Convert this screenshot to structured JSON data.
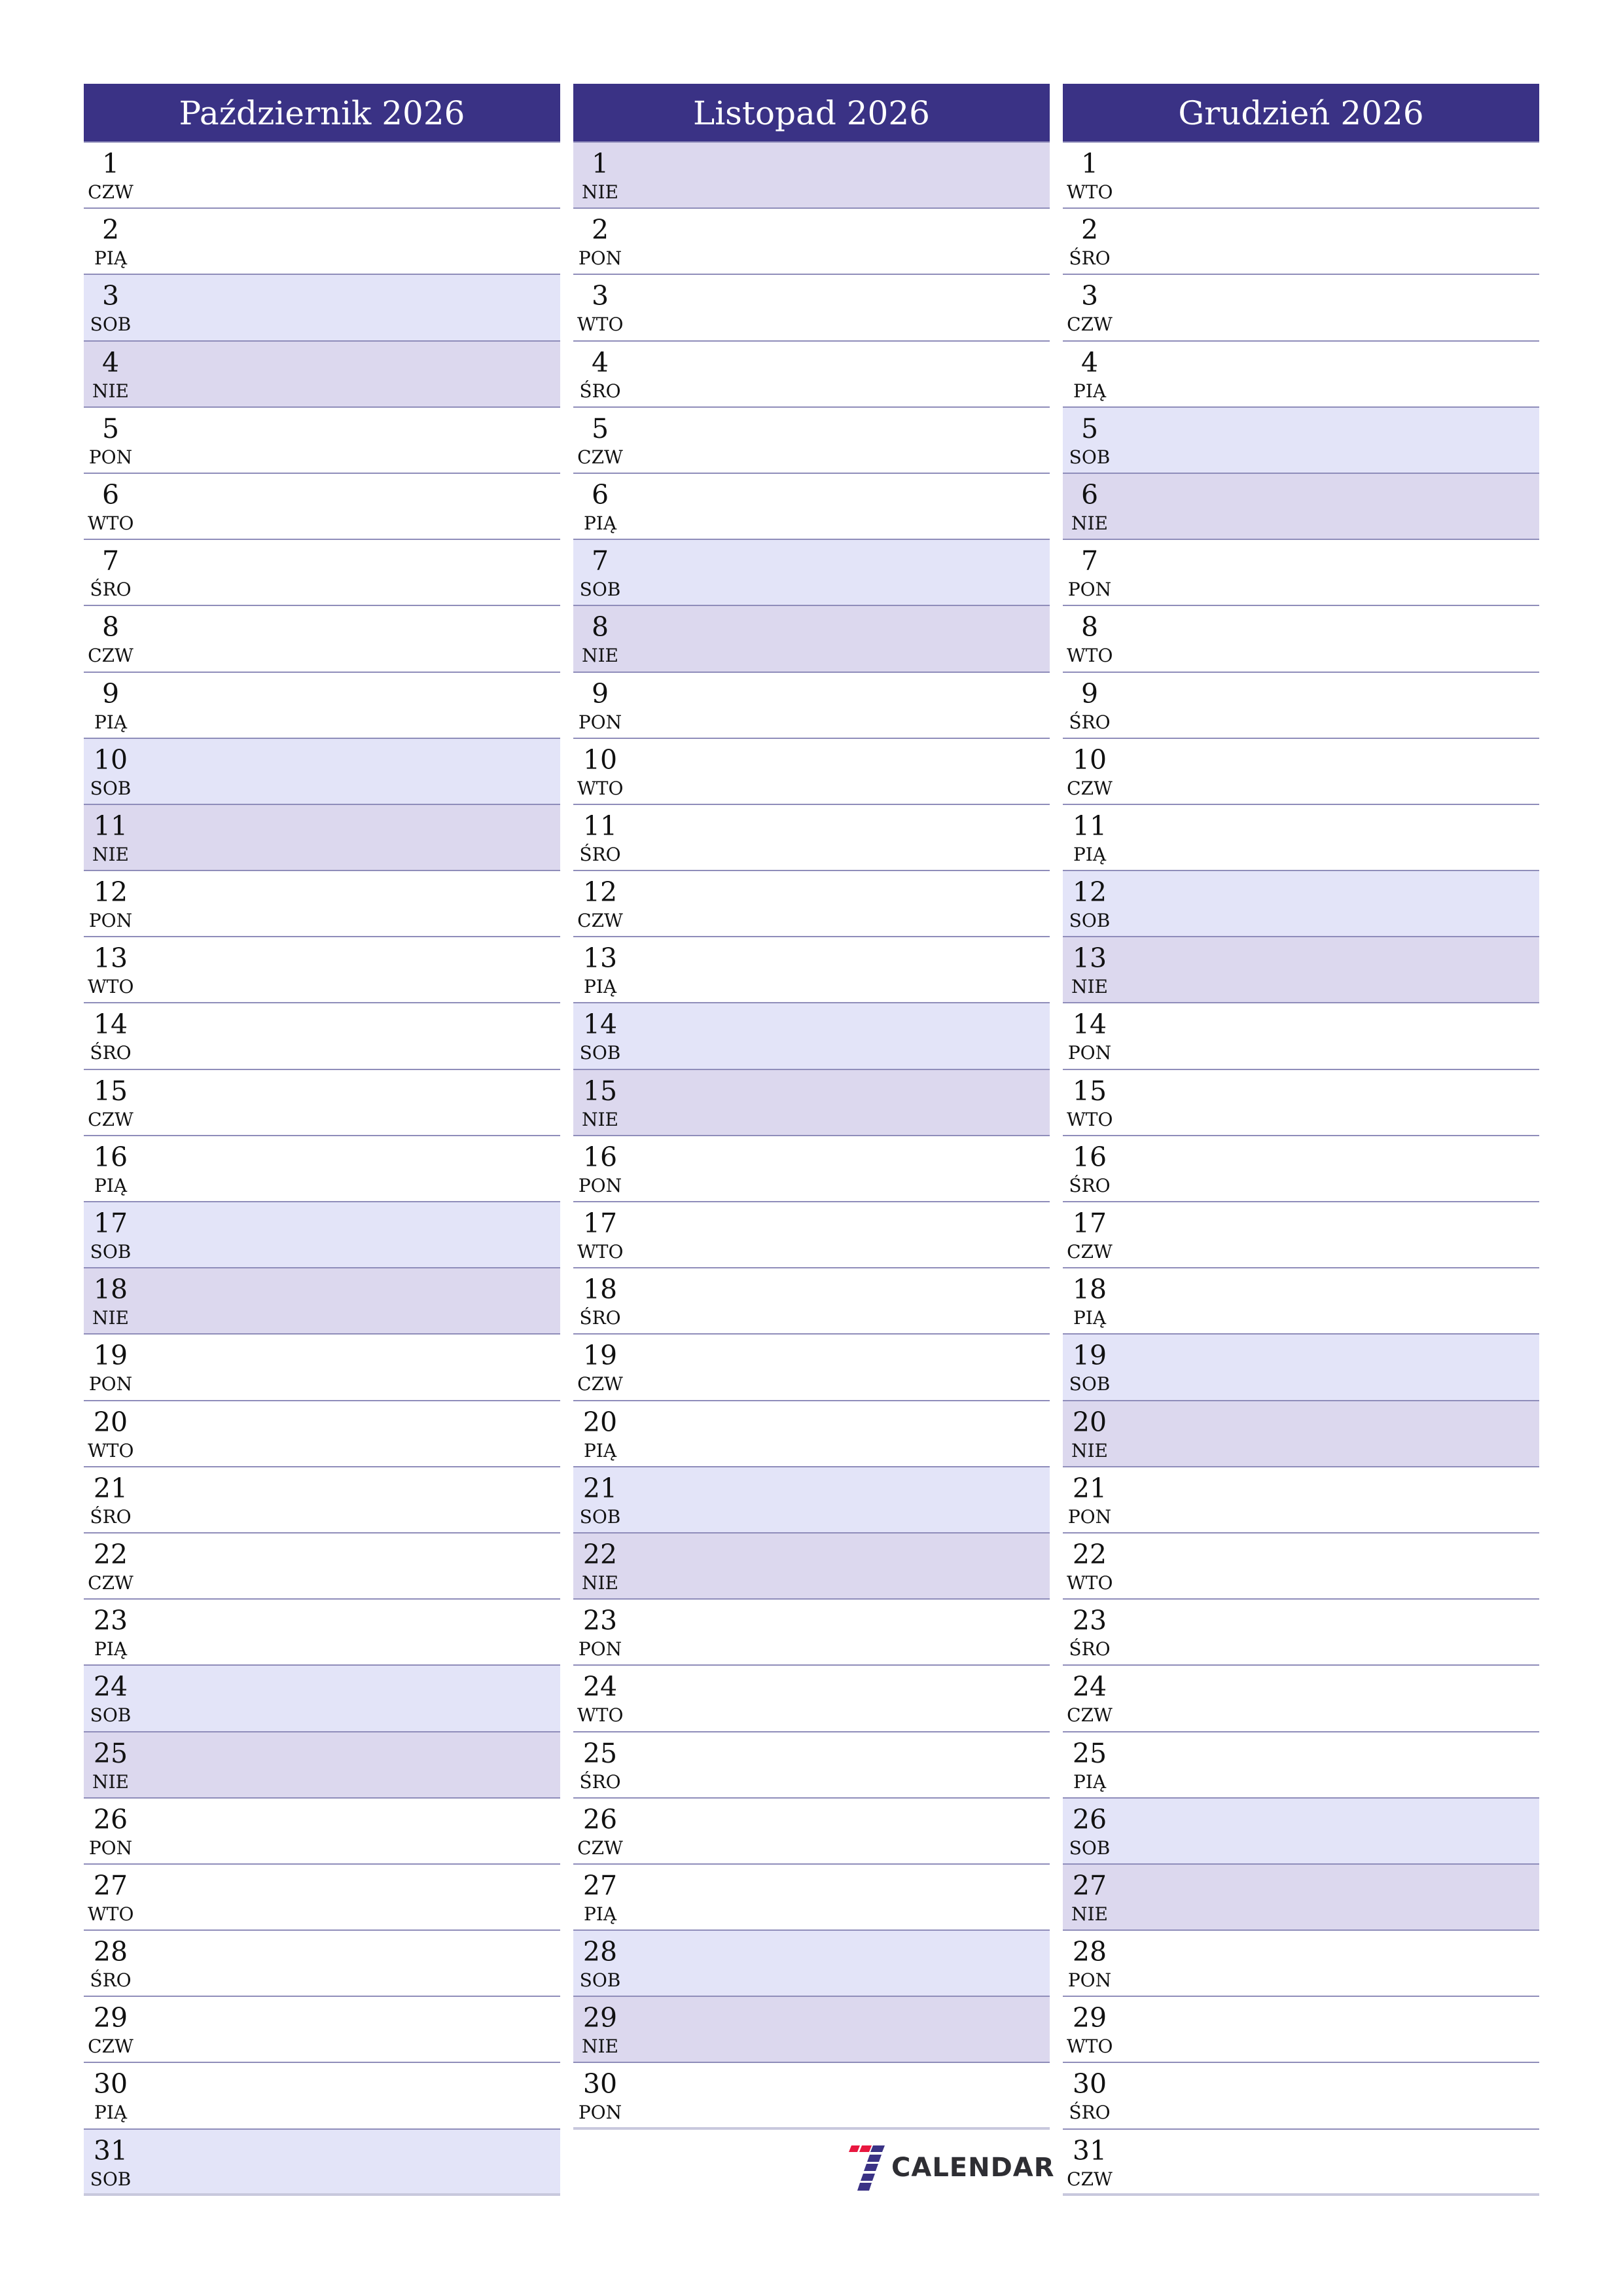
{
  "colors": {
    "header_bg": "#3a3285",
    "saturday_bg": "#e3e4f8",
    "sunday_bg": "#dcd8ee",
    "divider": "#8f8dba",
    "logo_red": "#e8173f",
    "logo_blue": "#3a3285",
    "logo_text": "#2e2e33"
  },
  "months": [
    {
      "title": "Październik 2026",
      "days": [
        {
          "day": "1",
          "weekday": "CZW"
        },
        {
          "day": "2",
          "weekday": "PIĄ"
        },
        {
          "day": "3",
          "weekday": "SOB"
        },
        {
          "day": "4",
          "weekday": "NIE"
        },
        {
          "day": "5",
          "weekday": "PON"
        },
        {
          "day": "6",
          "weekday": "WTO"
        },
        {
          "day": "7",
          "weekday": "ŚRO"
        },
        {
          "day": "8",
          "weekday": "CZW"
        },
        {
          "day": "9",
          "weekday": "PIĄ"
        },
        {
          "day": "10",
          "weekday": "SOB"
        },
        {
          "day": "11",
          "weekday": "NIE"
        },
        {
          "day": "12",
          "weekday": "PON"
        },
        {
          "day": "13",
          "weekday": "WTO"
        },
        {
          "day": "14",
          "weekday": "ŚRO"
        },
        {
          "day": "15",
          "weekday": "CZW"
        },
        {
          "day": "16",
          "weekday": "PIĄ"
        },
        {
          "day": "17",
          "weekday": "SOB"
        },
        {
          "day": "18",
          "weekday": "NIE"
        },
        {
          "day": "19",
          "weekday": "PON"
        },
        {
          "day": "20",
          "weekday": "WTO"
        },
        {
          "day": "21",
          "weekday": "ŚRO"
        },
        {
          "day": "22",
          "weekday": "CZW"
        },
        {
          "day": "23",
          "weekday": "PIĄ"
        },
        {
          "day": "24",
          "weekday": "SOB"
        },
        {
          "day": "25",
          "weekday": "NIE"
        },
        {
          "day": "26",
          "weekday": "PON"
        },
        {
          "day": "27",
          "weekday": "WTO"
        },
        {
          "day": "28",
          "weekday": "ŚRO"
        },
        {
          "day": "29",
          "weekday": "CZW"
        },
        {
          "day": "30",
          "weekday": "PIĄ"
        },
        {
          "day": "31",
          "weekday": "SOB"
        }
      ]
    },
    {
      "title": "Listopad 2026",
      "days": [
        {
          "day": "1",
          "weekday": "NIE"
        },
        {
          "day": "2",
          "weekday": "PON"
        },
        {
          "day": "3",
          "weekday": "WTO"
        },
        {
          "day": "4",
          "weekday": "ŚRO"
        },
        {
          "day": "5",
          "weekday": "CZW"
        },
        {
          "day": "6",
          "weekday": "PIĄ"
        },
        {
          "day": "7",
          "weekday": "SOB"
        },
        {
          "day": "8",
          "weekday": "NIE"
        },
        {
          "day": "9",
          "weekday": "PON"
        },
        {
          "day": "10",
          "weekday": "WTO"
        },
        {
          "day": "11",
          "weekday": "ŚRO"
        },
        {
          "day": "12",
          "weekday": "CZW"
        },
        {
          "day": "13",
          "weekday": "PIĄ"
        },
        {
          "day": "14",
          "weekday": "SOB"
        },
        {
          "day": "15",
          "weekday": "NIE"
        },
        {
          "day": "16",
          "weekday": "PON"
        },
        {
          "day": "17",
          "weekday": "WTO"
        },
        {
          "day": "18",
          "weekday": "ŚRO"
        },
        {
          "day": "19",
          "weekday": "CZW"
        },
        {
          "day": "20",
          "weekday": "PIĄ"
        },
        {
          "day": "21",
          "weekday": "SOB"
        },
        {
          "day": "22",
          "weekday": "NIE"
        },
        {
          "day": "23",
          "weekday": "PON"
        },
        {
          "day": "24",
          "weekday": "WTO"
        },
        {
          "day": "25",
          "weekday": "ŚRO"
        },
        {
          "day": "26",
          "weekday": "CZW"
        },
        {
          "day": "27",
          "weekday": "PIĄ"
        },
        {
          "day": "28",
          "weekday": "SOB"
        },
        {
          "day": "29",
          "weekday": "NIE"
        },
        {
          "day": "30",
          "weekday": "PON"
        }
      ]
    },
    {
      "title": "Grudzień 2026",
      "days": [
        {
          "day": "1",
          "weekday": "WTO"
        },
        {
          "day": "2",
          "weekday": "ŚRO"
        },
        {
          "day": "3",
          "weekday": "CZW"
        },
        {
          "day": "4",
          "weekday": "PIĄ"
        },
        {
          "day": "5",
          "weekday": "SOB"
        },
        {
          "day": "6",
          "weekday": "NIE"
        },
        {
          "day": "7",
          "weekday": "PON"
        },
        {
          "day": "8",
          "weekday": "WTO"
        },
        {
          "day": "9",
          "weekday": "ŚRO"
        },
        {
          "day": "10",
          "weekday": "CZW"
        },
        {
          "day": "11",
          "weekday": "PIĄ"
        },
        {
          "day": "12",
          "weekday": "SOB"
        },
        {
          "day": "13",
          "weekday": "NIE"
        },
        {
          "day": "14",
          "weekday": "PON"
        },
        {
          "day": "15",
          "weekday": "WTO"
        },
        {
          "day": "16",
          "weekday": "ŚRO"
        },
        {
          "day": "17",
          "weekday": "CZW"
        },
        {
          "day": "18",
          "weekday": "PIĄ"
        },
        {
          "day": "19",
          "weekday": "SOB"
        },
        {
          "day": "20",
          "weekday": "NIE"
        },
        {
          "day": "21",
          "weekday": "PON"
        },
        {
          "day": "22",
          "weekday": "WTO"
        },
        {
          "day": "23",
          "weekday": "ŚRO"
        },
        {
          "day": "24",
          "weekday": "CZW"
        },
        {
          "day": "25",
          "weekday": "PIĄ"
        },
        {
          "day": "26",
          "weekday": "SOB"
        },
        {
          "day": "27",
          "weekday": "NIE"
        },
        {
          "day": "28",
          "weekday": "PON"
        },
        {
          "day": "29",
          "weekday": "WTO"
        },
        {
          "day": "30",
          "weekday": "ŚRO"
        },
        {
          "day": "31",
          "weekday": "CZW"
        }
      ]
    }
  ],
  "weekend": {
    "saturday": "SOB",
    "sunday": "NIE"
  },
  "logo": {
    "text": "CALENDAR",
    "icon": "seven-logo-icon"
  }
}
